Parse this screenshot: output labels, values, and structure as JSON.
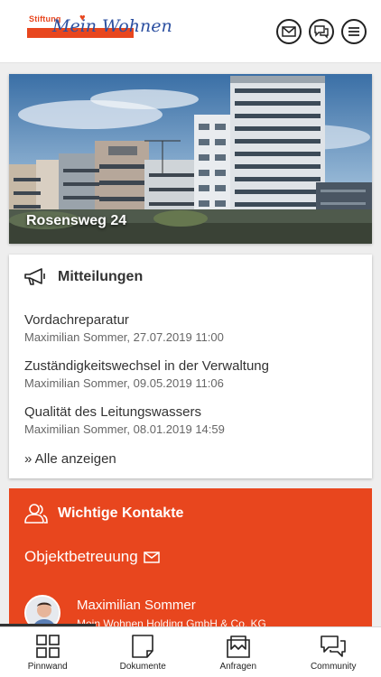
{
  "header": {
    "logo_small": "Stiftung",
    "logo_script": "Mein Wohnen",
    "icons": [
      "mail-icon",
      "chat-icon",
      "menu-icon"
    ]
  },
  "hero": {
    "title": "Rosensweg 24"
  },
  "messages": {
    "title": "Mitteilungen",
    "items": [
      {
        "title": "Vordachreparatur",
        "meta": "Maximilian Sommer, 27.07.2019 11:00"
      },
      {
        "title": "Zuständigkeitswechsel in der Verwaltung",
        "meta": "Maximilian Sommer, 09.05.2019 11:06"
      },
      {
        "title": "Qualität des Leitungswassers",
        "meta": "Maximilian Sommer, 08.01.2019 14:59"
      }
    ],
    "show_all": "» Alle anzeigen"
  },
  "contacts": {
    "title": "Wichtige Kontakte",
    "section": "Objektbetreuung",
    "person": {
      "name": "Maximilian Sommer",
      "company": "Mein Wohnen Holding GmbH & Co. KG"
    }
  },
  "nav": {
    "items": [
      {
        "label": "Pinnwand",
        "icon": "grid-icon"
      },
      {
        "label": "Dokumente",
        "icon": "document-icon"
      },
      {
        "label": "Anfragen",
        "icon": "inbox-icon"
      },
      {
        "label": "Community",
        "icon": "community-icon"
      }
    ]
  },
  "colors": {
    "accent": "#e8461e",
    "logo_blue": "#2b4fa0"
  }
}
